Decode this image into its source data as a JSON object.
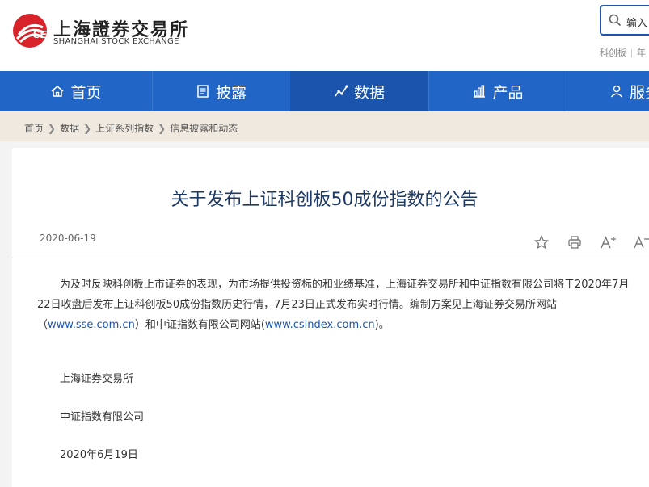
{
  "header": {
    "logo_cn": "上海證券交易所",
    "logo_en": "SHANGHAI STOCK EXCHANGE",
    "search_placeholder": "输入",
    "quick_links": [
      "科创板",
      "年"
    ]
  },
  "nav": {
    "items": [
      {
        "label": "首页",
        "icon": "home-icon"
      },
      {
        "label": "披露",
        "icon": "document-icon"
      },
      {
        "label": "数据",
        "icon": "chart-icon",
        "active": true
      },
      {
        "label": "产品",
        "icon": "bar-chart-icon"
      },
      {
        "label": "服务",
        "icon": "user-icon"
      }
    ]
  },
  "breadcrumb": [
    "首页",
    "数据",
    "上证系列指数",
    "信息披露和动态"
  ],
  "article": {
    "title": "关于发布上证科创板50成份指数的公告",
    "date": "2020-06-19",
    "tools": [
      "star-icon",
      "print-icon",
      "font-increase-icon",
      "font-decrease-icon"
    ],
    "para_part1": "为及时反映科创板上市证券的表现，为市场提供投资标的和业绩基准，上海证券交易所和中证指数有限公司将于2020年7月22日收盘后发布上证科创板50成份指数历史行情，7月23日正式发布实时行情。编制方案见上海证券交易所网站（",
    "link1": "www.sse.com.cn",
    "para_part2": "）和中证指数有限公司网站(",
    "link2": "www.csindex.com.cn",
    "para_part3": ")。",
    "signatures": [
      "上海证券交易所",
      "中证指数有限公司",
      "2020年6月19日"
    ]
  },
  "colors": {
    "nav_bg": "#2165c7",
    "nav_active": "#1a54ac",
    "logo_red": "#d8232a",
    "title_color": "#1e3a64",
    "link_color": "#1a56b0"
  }
}
